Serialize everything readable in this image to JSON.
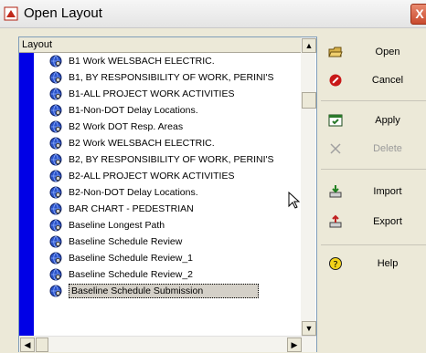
{
  "window": {
    "title": "Open Layout",
    "close_label": "X"
  },
  "list": {
    "header": "Layout",
    "items": [
      "B1 Work WELSBACH ELECTRIC.",
      "B1, BY RESPONSIBILITY OF WORK, PERINI'S",
      "B1-ALL PROJECT WORK ACTIVITIES",
      "B1-Non-DOT Delay Locations.",
      "B2 Work DOT Resp. Areas",
      "B2 Work WELSBACH ELECTRIC.",
      "B2, BY RESPONSIBILITY OF WORK, PERINI'S",
      "B2-ALL PROJECT WORK ACTIVITIES",
      "B2-Non-DOT Delay Locations.",
      "BAR CHART - PEDESTRIAN",
      "Baseline Longest Path",
      "Baseline Schedule Review",
      "Baseline Schedule Review_1",
      "Baseline Schedule Review_2",
      "Baseline Schedule Submission"
    ],
    "selected_index": 14
  },
  "buttons": {
    "open": "Open",
    "cancel": "Cancel",
    "apply": "Apply",
    "delete": "Delete",
    "import": "Import",
    "export": "Export",
    "help": "Help"
  },
  "colors": {
    "accent": "#0000e6",
    "window_bg": "#ece9d8",
    "close": "#d2583a"
  },
  "icons": [
    "open-layout-icon",
    "close-icon",
    "layout-globe-icon",
    "open-folder-icon",
    "cancel-icon",
    "apply-icon",
    "delete-icon",
    "import-icon",
    "export-icon",
    "help-icon",
    "mouse-cursor-icon"
  ]
}
